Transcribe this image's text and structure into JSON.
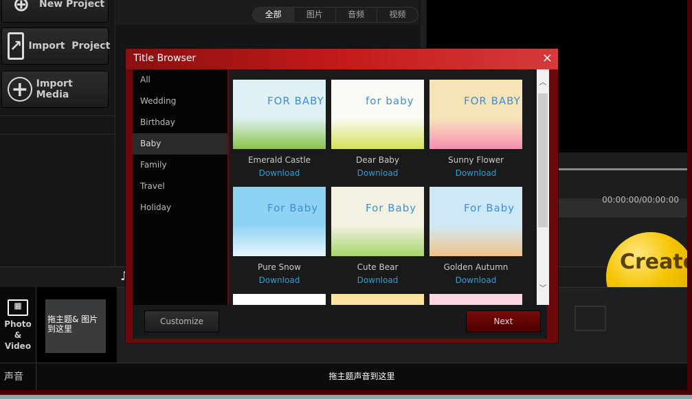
{
  "sidebar": {
    "new_project": "New Project",
    "import_project": "Import  Project",
    "import_media": "Import Media"
  },
  "filter_tabs": [
    "全部",
    "图片",
    "音频",
    "视频"
  ],
  "preview": {
    "timecode": "00:00:00/00:00:00"
  },
  "create_label": "Create",
  "timeline": {
    "photo_video_label": "Photo\n&\nVideo",
    "photo_drop": "拖主题& 图片到这里",
    "sound_label": "声音",
    "sound_drop": "拖主题声音到这里"
  },
  "dialog": {
    "title": "Title Browser",
    "close": "×",
    "categories": [
      "All",
      "Wedding",
      "Birthday",
      "Baby",
      "Family",
      "Travel",
      "Holiday"
    ],
    "selected_category": "Baby",
    "items": [
      {
        "name": "Emerald Castle",
        "action": "Download",
        "thumb_text": "FOR BABY",
        "colors": [
          "#dff1f4",
          "#8bc34a"
        ]
      },
      {
        "name": "Dear Baby",
        "action": "Download",
        "thumb_text": "for baby",
        "colors": [
          "#fbfbf6",
          "#d4e157"
        ]
      },
      {
        "name": "Sunny Flower",
        "action": "Download",
        "thumb_text": "FOR BABY",
        "colors": [
          "#f7e3b8",
          "#f48fb1"
        ]
      },
      {
        "name": "Pure Snow",
        "action": "Download",
        "thumb_text": "For Baby",
        "colors": [
          "#8fd3f4",
          "#e8f6fd"
        ]
      },
      {
        "name": "Cute Bear",
        "action": "Download",
        "thumb_text": "For Baby",
        "colors": [
          "#f4f1e2",
          "#a5d66b"
        ]
      },
      {
        "name": "Golden Autumn",
        "action": "Download",
        "thumb_text": "For Baby",
        "colors": [
          "#cfe8f5",
          "#f0c48a"
        ]
      }
    ],
    "customize": "Customize",
    "next": "Next"
  }
}
